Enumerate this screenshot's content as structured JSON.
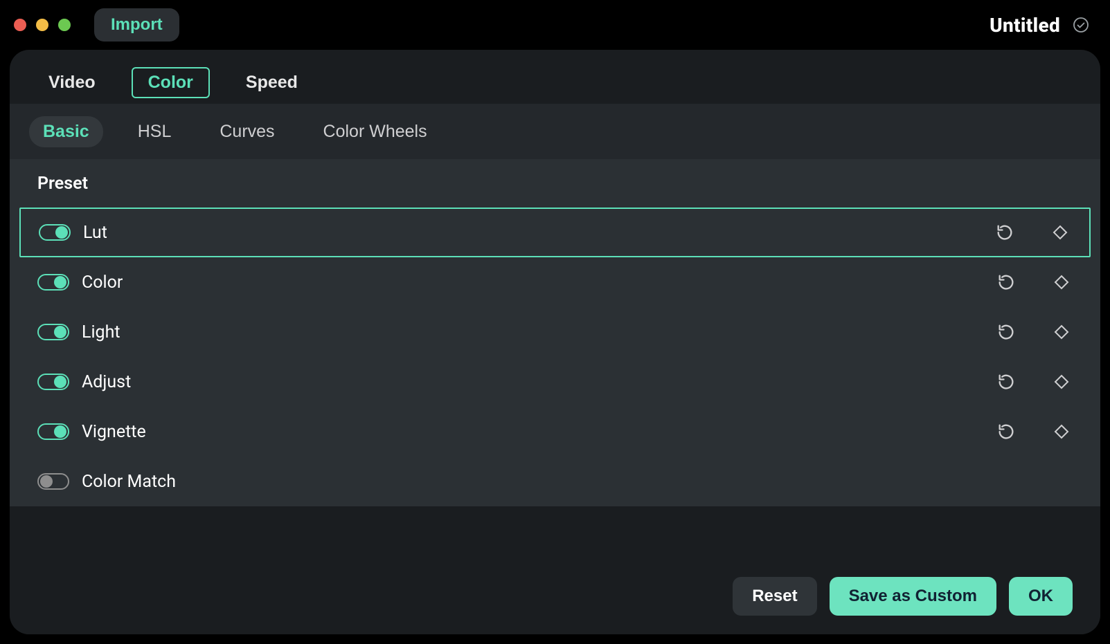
{
  "header": {
    "import_label": "Import",
    "title": "Untitled"
  },
  "top_tabs": [
    {
      "id": "video",
      "label": "Video",
      "active": false
    },
    {
      "id": "color",
      "label": "Color",
      "active": true
    },
    {
      "id": "speed",
      "label": "Speed",
      "active": false
    }
  ],
  "sub_tabs": [
    {
      "id": "basic",
      "label": "Basic",
      "active": true
    },
    {
      "id": "hsl",
      "label": "HSL",
      "active": false
    },
    {
      "id": "curves",
      "label": "Curves",
      "active": false
    },
    {
      "id": "color-wheels",
      "label": "Color Wheels",
      "active": false
    }
  ],
  "preset_header": "Preset",
  "rows": [
    {
      "id": "lut",
      "label": "Lut",
      "enabled": true,
      "selected": true,
      "has_actions": true
    },
    {
      "id": "color",
      "label": "Color",
      "enabled": true,
      "selected": false,
      "has_actions": true
    },
    {
      "id": "light",
      "label": "Light",
      "enabled": true,
      "selected": false,
      "has_actions": true
    },
    {
      "id": "adjust",
      "label": "Adjust",
      "enabled": true,
      "selected": false,
      "has_actions": true
    },
    {
      "id": "vignette",
      "label": "Vignette",
      "enabled": true,
      "selected": false,
      "has_actions": true
    },
    {
      "id": "color-match",
      "label": "Color Match",
      "enabled": false,
      "selected": false,
      "has_actions": false
    }
  ],
  "footer": {
    "reset_label": "Reset",
    "save_label": "Save as Custom",
    "ok_label": "OK"
  },
  "colors": {
    "accent": "#5ce0b8"
  }
}
